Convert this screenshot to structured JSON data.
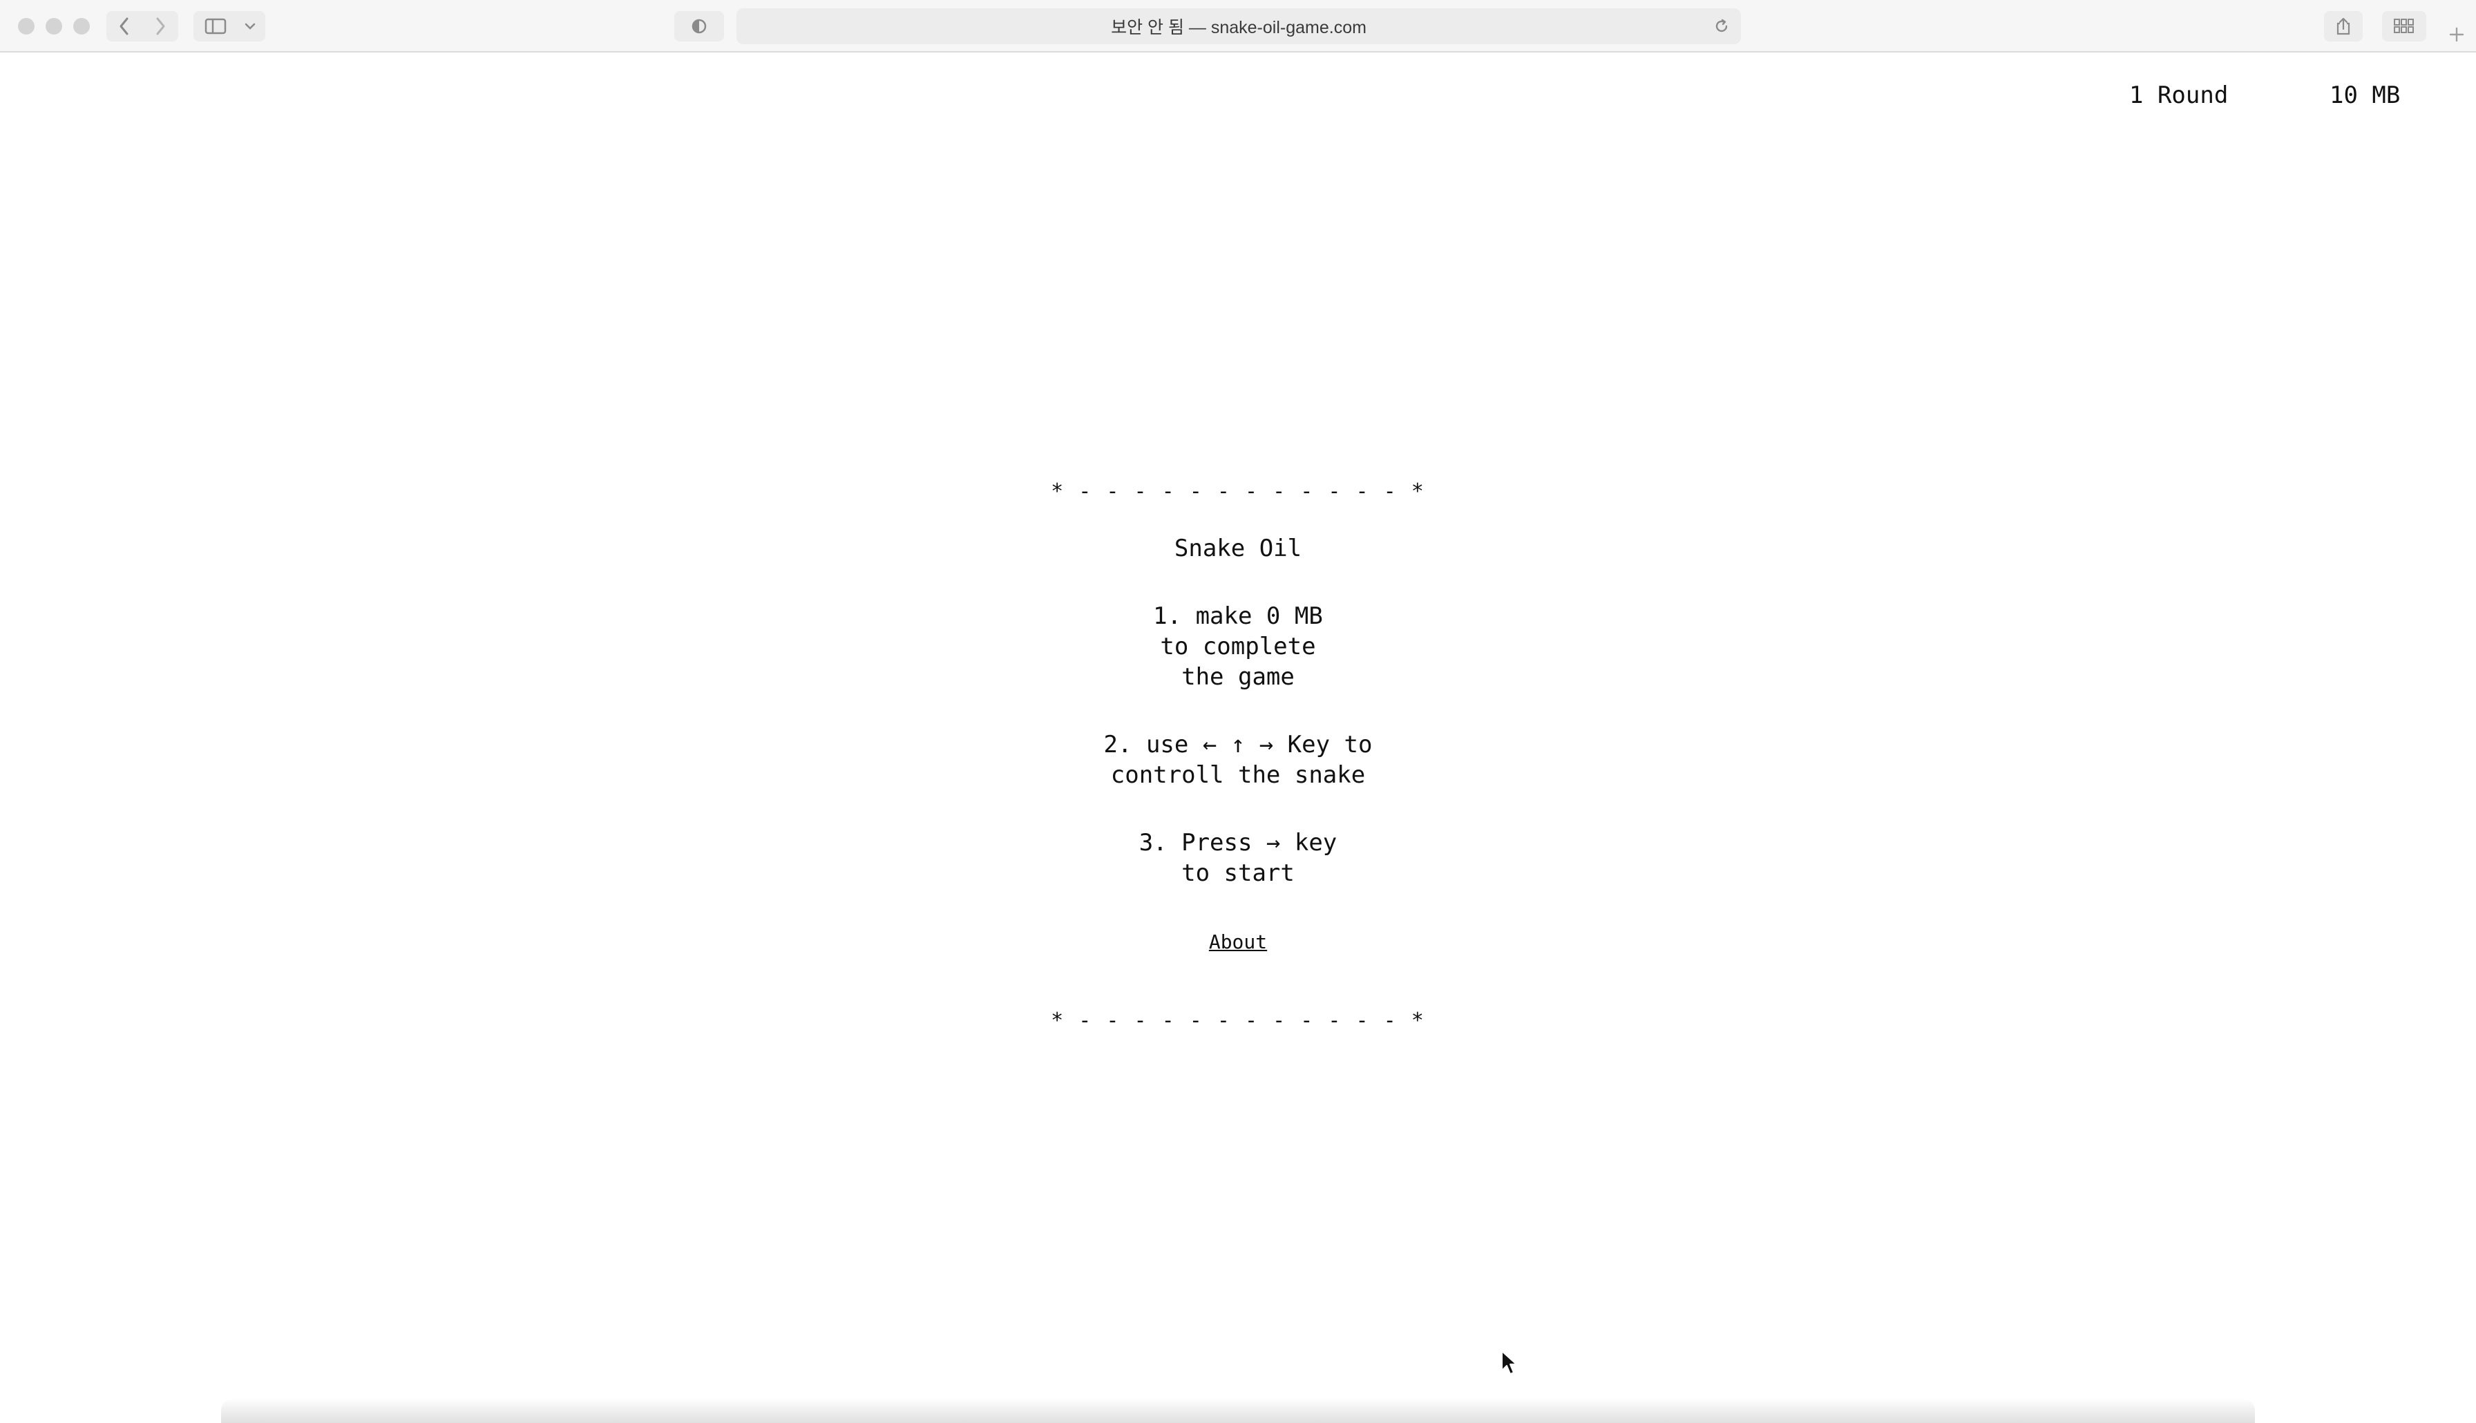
{
  "browser": {
    "url_display": "보안 안 됨 — snake-oil-game.com",
    "icons": {
      "back": "chevron-left-icon",
      "forward": "chevron-right-icon",
      "sidebar": "sidebar-icon",
      "sidebar_menu": "chevron-down-icon",
      "privacy": "shield-half-icon",
      "reload": "reload-icon",
      "share": "share-icon",
      "tabs": "grid-icon",
      "new_tab": "plus-icon"
    }
  },
  "hud": {
    "round": "1 Round",
    "mb": "10 MB"
  },
  "panel": {
    "border_top": "* - - - - - - - - - - - - *",
    "title": "Snake Oil",
    "rule1": [
      "1. make 0 MB",
      "to complete",
      "the game"
    ],
    "rule2": [
      "2. use ← ↑ → Key to",
      "controll the snake"
    ],
    "rule3": [
      "3. Press → key",
      "to start"
    ],
    "about_link": "About",
    "border_bottom": "* - - - - - - - - - - - - *"
  },
  "colors": {
    "text": "#111111",
    "toolbar_bg": "#f6f6f6",
    "page_bg": "#ffffff"
  }
}
